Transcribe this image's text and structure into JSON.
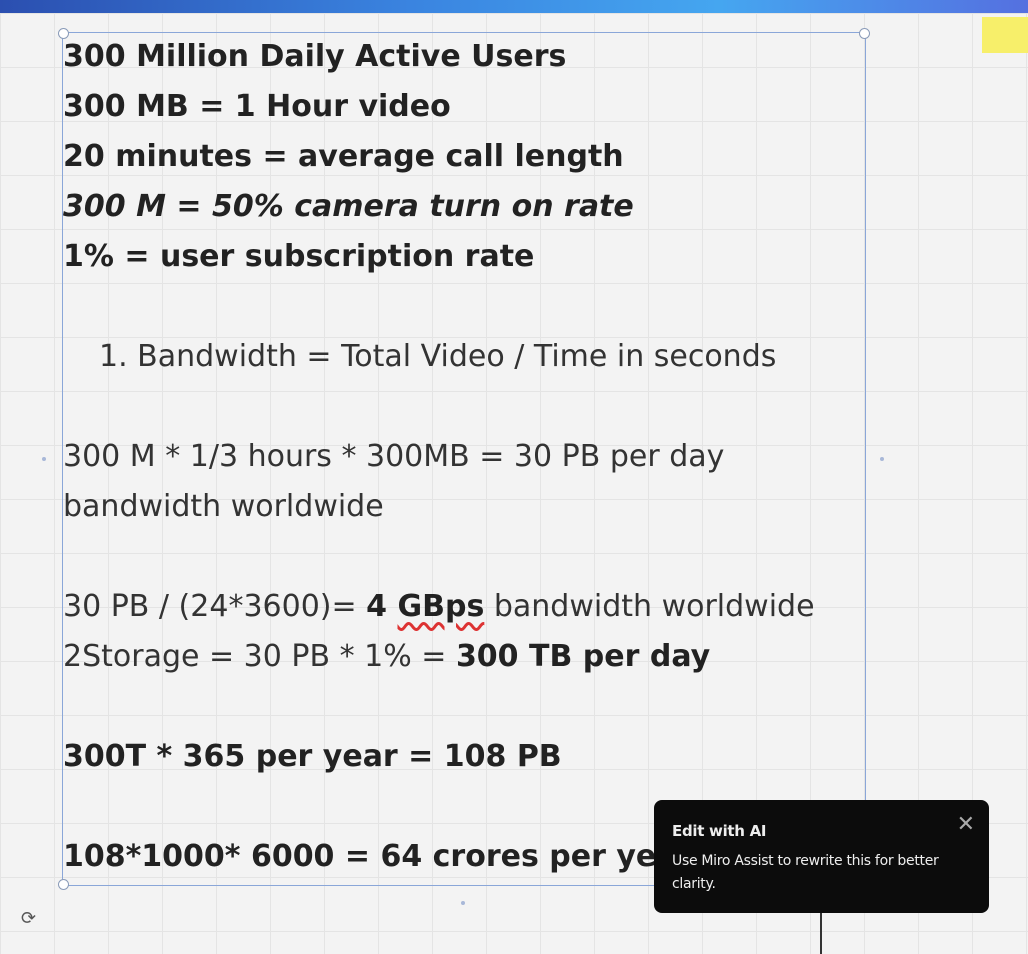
{
  "board": {
    "lines": [
      {
        "segments": [
          {
            "text": "300 Million Daily Active Users",
            "style": "b"
          }
        ]
      },
      {
        "segments": [
          {
            "text": "300 MB = 1 Hour video",
            "style": "b"
          }
        ]
      },
      {
        "segments": [
          {
            "text": "20 minutes = average call length",
            "style": "b"
          }
        ]
      },
      {
        "segments": [
          {
            "text": "300 M = 50% camera turn on rate",
            "style": "b i"
          }
        ]
      },
      {
        "segments": [
          {
            "text": "1% = user subscription rate",
            "style": "b"
          }
        ]
      },
      {
        "segments": [
          {
            "text": "1. Bandwidth = Total Video / Time in seconds",
            "style": "n"
          }
        ]
      },
      {
        "segments": [
          {
            "text": "300 M * 1/3 hours * 300MB = 30 PB per day",
            "style": "n"
          }
        ]
      },
      {
        "segments": [
          {
            "text": "bandwidth worldwide",
            "style": "n"
          }
        ]
      },
      {
        "segments": [
          {
            "text": "30 PB / (24*3600)= ",
            "style": "n"
          },
          {
            "text": "4 ",
            "style": "b"
          },
          {
            "text": "GBps",
            "style": "b"
          },
          {
            "text": " bandwidth worldwide",
            "style": "n"
          }
        ]
      },
      {
        "segments": [
          {
            "text": "2Storage = 30 PB * 1% = ",
            "style": "n"
          },
          {
            "text": "300 TB per day",
            "style": "b"
          }
        ]
      },
      {
        "segments": [
          {
            "text": "300T * 365 per year = 108 PB",
            "style": "b"
          }
        ]
      },
      {
        "segments": [
          {
            "text": "108*1000* 6000 =  64 crores per year",
            "style": "b"
          }
        ]
      }
    ]
  },
  "popup": {
    "title": "Edit with AI",
    "body": "Use Miro Assist to rewrite this for better clarity.",
    "close_icon": "close-icon"
  },
  "colors": {
    "popup_bg": "#0c0c0c",
    "selection": "#8aa6d8",
    "sticky_note": "#f7ef6a"
  }
}
